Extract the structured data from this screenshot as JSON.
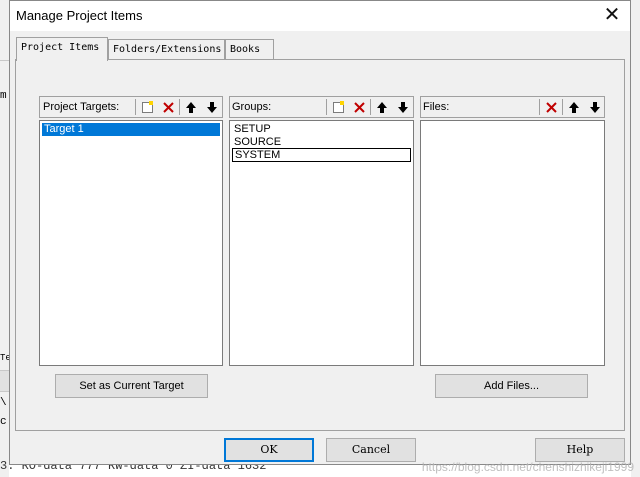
{
  "window": {
    "title": "Manage Project Items"
  },
  "tabs": [
    {
      "label": "Project Items",
      "active": true
    },
    {
      "label": "Folders/Extensions",
      "active": false
    },
    {
      "label": "Books",
      "active": false
    }
  ],
  "targets": {
    "label": "Project Targets:",
    "items": [
      "Target 1"
    ],
    "selected_index": 0,
    "button": "Set as Current Target"
  },
  "groups": {
    "label": "Groups:",
    "items": [
      "SETUP",
      "SOURCE",
      "SYSTEM"
    ],
    "focused_index": 2
  },
  "files": {
    "label": "Files:",
    "items": [],
    "button": "Add Files..."
  },
  "footer": {
    "ok": "OK",
    "cancel": "Cancel",
    "help": "Help"
  },
  "background": {
    "bottom_text": "3: RO-data 777 RW-data 0 ZI-data 1632",
    "watermark": "https://blog.csdn.net/chenshizhikeji1999",
    "left_glyphs": [
      "m",
      "Te",
      "\\",
      "c"
    ]
  },
  "colors": {
    "selection": "#0078d7",
    "dialog_bg": "#f0f0f0",
    "delete_red": "#c00000"
  }
}
